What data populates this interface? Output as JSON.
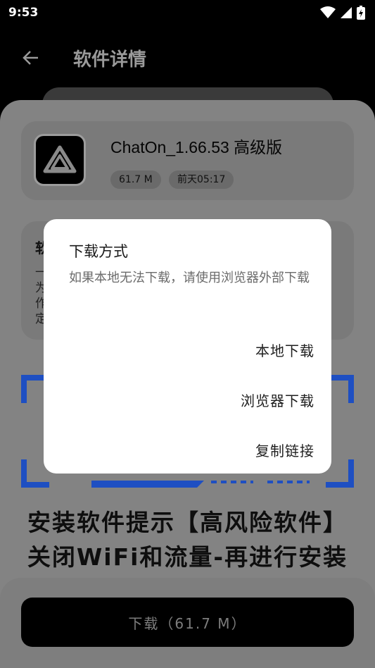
{
  "status_bar": {
    "time": "9:53"
  },
  "app_bar": {
    "title": "软件详情"
  },
  "app": {
    "name": "ChatOn_1.66.53 高级版",
    "size": "61.7 M",
    "date": "前天05:17"
  },
  "description": {
    "title": "软",
    "body": "一\n为\n作\n定"
  },
  "banner": {
    "line1": "安装软件提示【高风险软件】",
    "line2": "关闭WiFi和流量-再进行安装"
  },
  "download_button": {
    "label": "下载（61.7 M）"
  },
  "dialog": {
    "title": "下载方式",
    "message": "如果本地无法下载，请使用浏览器外部下载",
    "options": [
      "本地下载",
      "浏览器下载",
      "复制链接"
    ]
  },
  "colors": {
    "dialog_bg": "#ffffff",
    "scrim": "#838383",
    "button_bg": "#000000"
  }
}
